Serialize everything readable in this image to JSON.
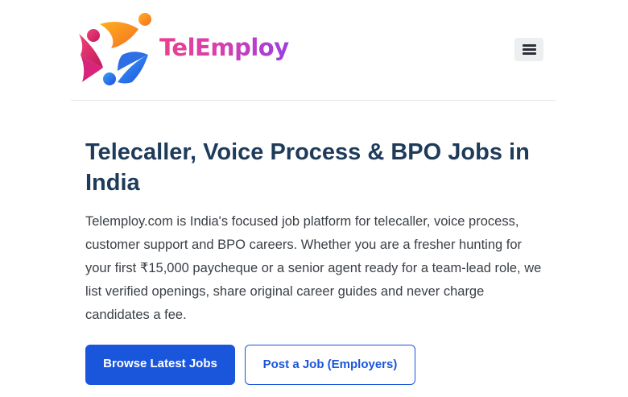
{
  "header": {
    "logo": {
      "text": "TelEmploy",
      "icon": "people-logo-icon"
    },
    "menu_icon": "hamburger-menu-icon"
  },
  "hero": {
    "title": "Telecaller, Voice Process & BPO Jobs in India",
    "description": "Telemploy.com is India's focused job platform for telecaller, voice process, customer support and BPO careers. Whether you are a fresher hunting for your first ₹15,000 paycheque or a senior agent ready for a team-lead role, we list verified openings, share original career guides and never charge candidates a fee."
  },
  "actions": {
    "primary_label": "Browse Latest Jobs",
    "secondary_label": "Post a Job (Employers)"
  },
  "colors": {
    "accent": "#1a56db",
    "heading": "#1f3b5a",
    "body_text": "#3a3f45",
    "logo_gradient_start": "#e8408f",
    "logo_gradient_end": "#9b3fe0"
  }
}
